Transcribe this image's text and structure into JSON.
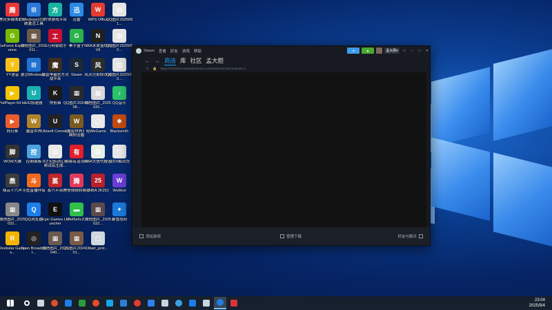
{
  "desktop_icons": [
    {
      "label": "腾讯多媒体助手",
      "color": "#e8393a",
      "glyph": "腾"
    },
    {
      "label": "Windows10系统激活工具",
      "color": "#2b79d8",
      "glyph": "⊞"
    },
    {
      "label": "方块游戏平台",
      "color": "#18b4a0",
      "glyph": "方"
    },
    {
      "label": "迅雷",
      "color": "#2a8be3",
      "glyph": "迅"
    },
    {
      "label": "WPS Office",
      "color": "#e33c2e",
      "glyph": "W"
    },
    {
      "label": "QQ图片2025091...",
      "color": "#e5e5e5",
      "glyph": "▤"
    },
    {
      "label": "GeForce Experience",
      "color": "#76b900",
      "glyph": "G"
    },
    {
      "label": "微信图片_2025011...",
      "color": "#6d5a4a",
      "glyph": "▦"
    },
    {
      "label": "工行网银助手",
      "color": "#c8102e",
      "glyph": "工"
    },
    {
      "label": "拳手盒子",
      "color": "#2bb24c",
      "glyph": "G"
    },
    {
      "label": "NBA水友篮规则V9",
      "color": "#1f1f1f",
      "glyph": "N"
    },
    {
      "label": "QQ图片2025090...",
      "color": "#e5e5e5",
      "glyph": "▤"
    },
    {
      "label": "YY语音",
      "color": "#f5c21b",
      "glyph": "Y"
    },
    {
      "label": "激活Windows...",
      "color": "#1f74d1",
      "glyph": "⊞"
    },
    {
      "label": "魔兽争霸官方对战平台",
      "color": "#3b2d20",
      "glyph": "魔"
    },
    {
      "label": "Steam",
      "color": "#1b2838",
      "glyph": "S"
    },
    {
      "label": "风灵月影修改器",
      "color": "#2c2c2c",
      "glyph": "风"
    },
    {
      "label": "QQ图片2025090...",
      "color": "#e5e5e5",
      "glyph": "▤"
    },
    {
      "label": "PotPlayer 64 bit",
      "color": "#f2c500",
      "glyph": "▶"
    },
    {
      "label": "UU加速器",
      "color": "#1ab0b0",
      "glyph": "U"
    },
    {
      "label": "快剪辑",
      "color": "#1a1a1a",
      "glyph": "K"
    },
    {
      "label": "QQ图片20240708...",
      "color": "#2a2a2a",
      "glyph": "▦"
    },
    {
      "label": "微信图片_2025032...",
      "color": "#d8d8d8",
      "glyph": "▦"
    },
    {
      "label": "QQ音乐",
      "color": "#2dc26b",
      "glyph": "♪"
    },
    {
      "label": "向日葵",
      "color": "#e85d2c",
      "glyph": "▶"
    },
    {
      "label": "魔兽世界",
      "color": "#b0832a",
      "glyph": "W"
    },
    {
      "label": "Ubisoft Connect",
      "color": "#222",
      "glyph": "U"
    },
    {
      "label": "《魔兽世界》经典怀旧服",
      "color": "#7a5a20",
      "glyph": "W"
    },
    {
      "label": "WeGame",
      "color": "#e8e8e8",
      "glyph": "▢"
    },
    {
      "label": "Blacksmith",
      "color": "#c24b12",
      "glyph": "✱"
    },
    {
      "label": "WOW大脚",
      "color": "#333",
      "glyph": "脚"
    },
    {
      "label": "控制面板",
      "color": "#4da3e0",
      "glyph": "控"
    },
    {
      "label": "IFZ无感动区视频试玩生成...",
      "color": "#e8e8e8",
      "glyph": "▤"
    },
    {
      "label": "网易有道词典",
      "color": "#e0202a",
      "glyph": "有"
    },
    {
      "label": "NBA文信代报告",
      "color": "#e6efe6",
      "glyph": "▤"
    },
    {
      "label": "双DX解出馆",
      "color": "#e8e8e8",
      "glyph": "▢"
    },
    {
      "label": "鼎云十六声",
      "color": "#3c3c3c",
      "glyph": "鼎"
    },
    {
      "label": "斗鱼直播伴侣",
      "color": "#f06a1d",
      "glyph": "斗"
    },
    {
      "label": "蒸汽平台",
      "color": "#c0282c",
      "glyph": "蒸"
    },
    {
      "label": "腾信视频转换器",
      "color": "#e0395a",
      "glyph": "腾"
    },
    {
      "label": "《NBA 2K25》",
      "color": "#b8202b",
      "glyph": "25"
    },
    {
      "label": "WeMod",
      "color": "#6a3fd6",
      "glyph": "W"
    },
    {
      "label": "微信图片_2025032...",
      "color": "#888",
      "glyph": "▦"
    },
    {
      "label": "QQ浏览器",
      "color": "#1e7ee8",
      "glyph": "Q"
    },
    {
      "label": "Epic Games Launcher",
      "color": "#111",
      "glyph": "E"
    },
    {
      "label": "5ffef5e6c3...",
      "color": "#2fbf4a",
      "glyph": "▬"
    },
    {
      "label": "微信图片_2025032...",
      "color": "#5b4a4a",
      "glyph": "▦"
    },
    {
      "label": "暴雪战网",
      "color": "#1c7bd9",
      "glyph": "✦"
    },
    {
      "label": "Rockstar Games...",
      "color": "#f5b400",
      "glyph": "R"
    },
    {
      "label": "Open Broadcast...",
      "color": "#222",
      "glyph": "◎"
    },
    {
      "label": "微信图片_2025040...",
      "color": "#6a5a50",
      "glyph": "▦"
    },
    {
      "label": "QQ图片20241001...",
      "color": "#7a5a48",
      "glyph": "▦"
    },
    {
      "label": "start_prot...",
      "color": "#cfd8e0",
      "glyph": "▢"
    }
  ],
  "steam": {
    "menu": [
      "Steam",
      "查看",
      "好友",
      "游戏",
      "帮助"
    ],
    "username": "孟大胆",
    "tabs": [
      "商店",
      "库",
      "社区",
      "孟大胆"
    ],
    "url": "https://checkout.steampowered.com/checkout/?accountcart=1",
    "bottom_left": "添加游戏",
    "bottom_center": "管理下载",
    "bottom_right": "好友与聊天"
  },
  "taskbar": {
    "time": "23:04",
    "date": "2025/9/4",
    "apps": [
      "start",
      "search",
      "task-view",
      "app1",
      "qq",
      "xbox",
      "browser",
      "edge",
      "store",
      "wps",
      "app2",
      "steam",
      "app3",
      "qq-browser",
      "steam2",
      "browser-active",
      "app4"
    ]
  }
}
